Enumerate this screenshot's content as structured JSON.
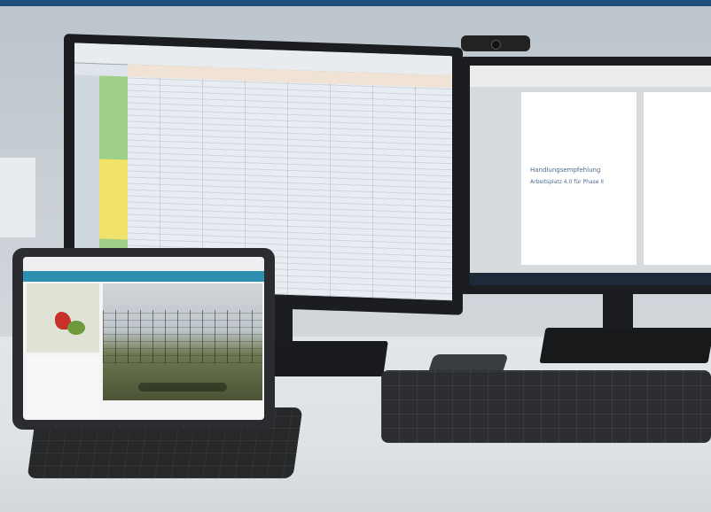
{
  "scene": {
    "description_labels": {
      "right_monitor_document_title": "Handlungsempfehlung",
      "right_monitor_document_subtitle": "Arbeitsplatz 4.0 für Phase II"
    },
    "colors": {
      "top_bar": "#1f4f7c",
      "tablet_header": "#2f8fb0",
      "spreadsheet_green": "#9fd08a",
      "spreadsheet_yellow": "#f1e26a"
    }
  }
}
